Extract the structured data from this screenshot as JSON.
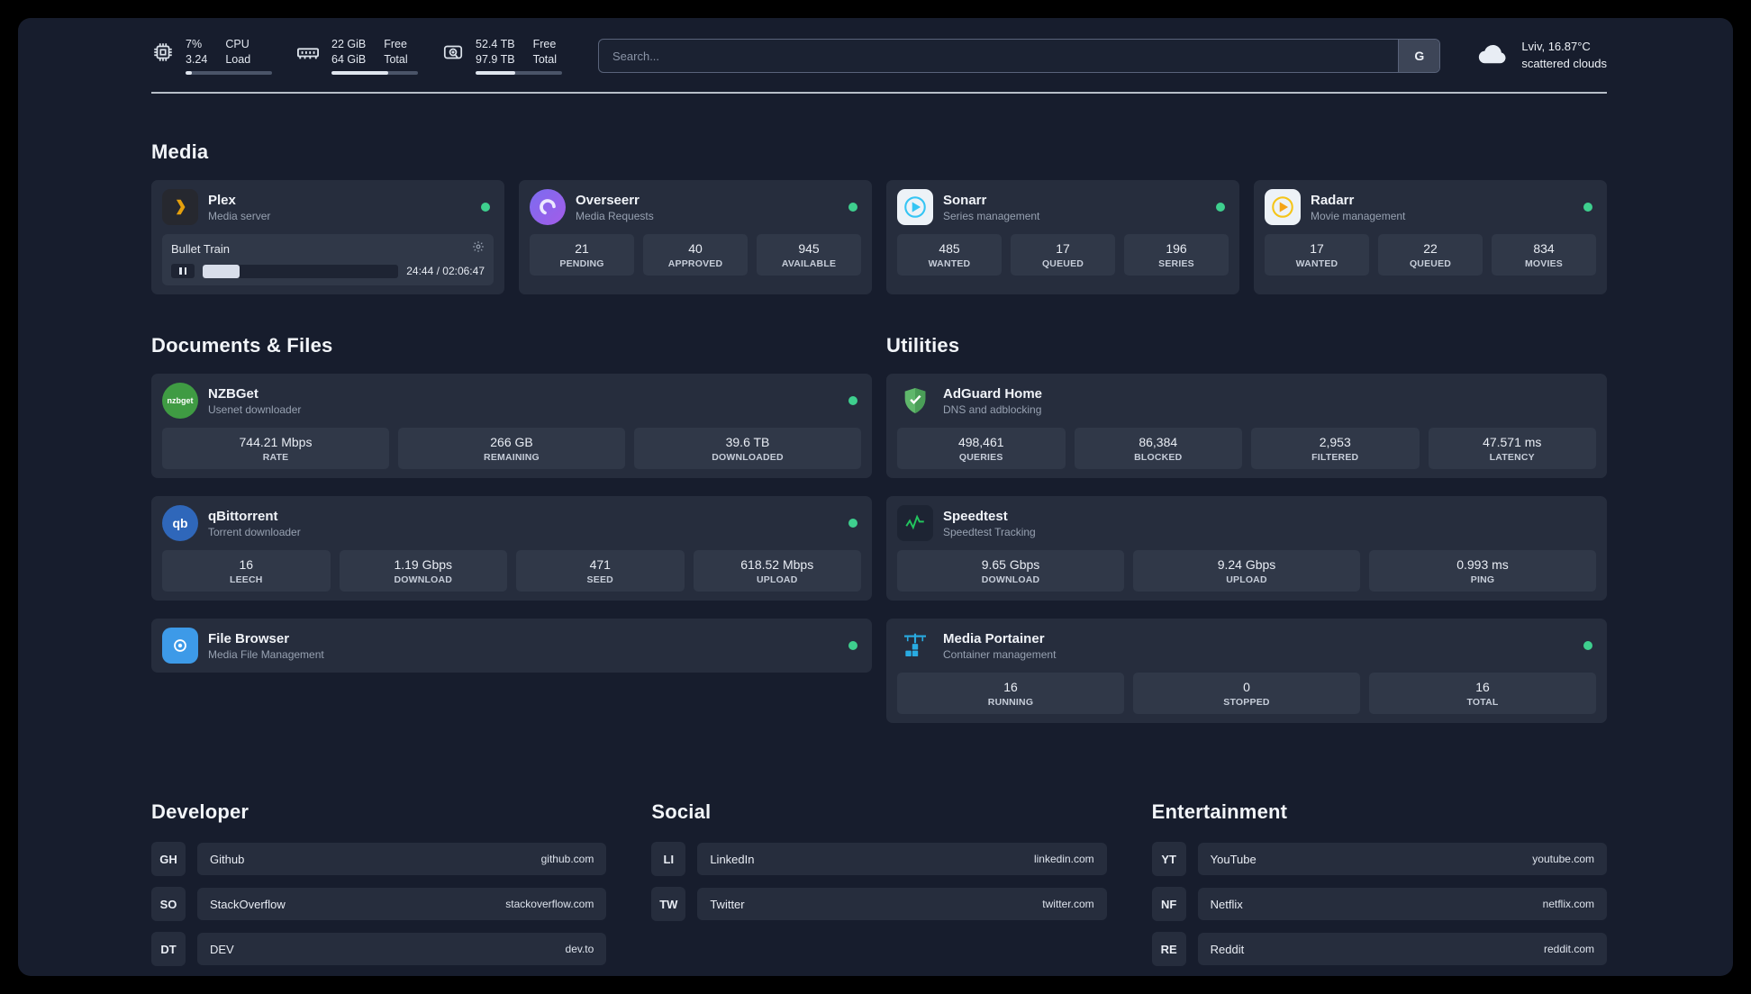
{
  "topbar": {
    "cpu": {
      "percent": "7%",
      "load": "3.24",
      "label1": "CPU",
      "label2": "Load"
    },
    "ram": {
      "free": "22 GiB",
      "total": "64 GiB",
      "label1": "Free",
      "label2": "Total"
    },
    "disk": {
      "free": "52.4 TB",
      "total": "97.9 TB",
      "label1": "Free",
      "label2": "Total"
    },
    "search": {
      "placeholder": "Search...",
      "button": "G"
    },
    "weather": {
      "location": "Lviv, 16.87°C",
      "condition": "scattered clouds"
    }
  },
  "media": {
    "title": "Media",
    "plex": {
      "name": "Plex",
      "subtitle": "Media server",
      "track": "Bullet Train",
      "time": "24:44 / 02:06:47"
    },
    "apps": [
      {
        "name": "Overseerr",
        "subtitle": "Media Requests",
        "stats": [
          {
            "value": "21",
            "label": "PENDING"
          },
          {
            "value": "40",
            "label": "APPROVED"
          },
          {
            "value": "945",
            "label": "AVAILABLE"
          }
        ]
      },
      {
        "name": "Sonarr",
        "subtitle": "Series management",
        "stats": [
          {
            "value": "485",
            "label": "WANTED"
          },
          {
            "value": "17",
            "label": "QUEUED"
          },
          {
            "value": "196",
            "label": "SERIES"
          }
        ]
      },
      {
        "name": "Radarr",
        "subtitle": "Movie management",
        "stats": [
          {
            "value": "17",
            "label": "WANTED"
          },
          {
            "value": "22",
            "label": "QUEUED"
          },
          {
            "value": "834",
            "label": "MOVIES"
          }
        ]
      }
    ]
  },
  "docs": {
    "title": "Documents & Files",
    "apps": [
      {
        "name": "NZBGet",
        "subtitle": "Usenet downloader",
        "icon_text": "nzbget",
        "stats": [
          {
            "value": "744.21 Mbps",
            "label": "RATE"
          },
          {
            "value": "266 GB",
            "label": "REMAINING"
          },
          {
            "value": "39.6 TB",
            "label": "DOWNLOADED"
          }
        ]
      },
      {
        "name": "qBittorrent",
        "subtitle": "Torrent downloader",
        "icon_text": "qb",
        "stats": [
          {
            "value": "16",
            "label": "LEECH"
          },
          {
            "value": "1.19 Gbps",
            "label": "DOWNLOAD"
          },
          {
            "value": "471",
            "label": "SEED"
          },
          {
            "value": "618.52 Mbps",
            "label": "UPLOAD"
          }
        ]
      },
      {
        "name": "File Browser",
        "subtitle": "Media File Management",
        "stats": []
      }
    ]
  },
  "utils": {
    "title": "Utilities",
    "apps": [
      {
        "name": "AdGuard Home",
        "subtitle": "DNS and adblocking",
        "stats": [
          {
            "value": "498,461",
            "label": "QUERIES"
          },
          {
            "value": "86,384",
            "label": "BLOCKED"
          },
          {
            "value": "2,953",
            "label": "FILTERED"
          },
          {
            "value": "47.571 ms",
            "label": "LATENCY"
          }
        ]
      },
      {
        "name": "Speedtest",
        "subtitle": "Speedtest Tracking",
        "stats": [
          {
            "value": "9.65 Gbps",
            "label": "DOWNLOAD"
          },
          {
            "value": "9.24 Gbps",
            "label": "UPLOAD"
          },
          {
            "value": "0.993 ms",
            "label": "PING"
          }
        ]
      },
      {
        "name": "Media Portainer",
        "subtitle": "Container management",
        "stats": [
          {
            "value": "16",
            "label": "RUNNING"
          },
          {
            "value": "0",
            "label": "STOPPED"
          },
          {
            "value": "16",
            "label": "TOTAL"
          }
        ]
      }
    ]
  },
  "bookmarks": {
    "groups": [
      {
        "title": "Developer",
        "items": [
          {
            "abbr": "GH",
            "name": "Github",
            "url": "github.com"
          },
          {
            "abbr": "SO",
            "name": "StackOverflow",
            "url": "stackoverflow.com"
          },
          {
            "abbr": "DT",
            "name": "DEV",
            "url": "dev.to"
          }
        ]
      },
      {
        "title": "Social",
        "items": [
          {
            "abbr": "LI",
            "name": "LinkedIn",
            "url": "linkedin.com"
          },
          {
            "abbr": "TW",
            "name": "Twitter",
            "url": "twitter.com"
          }
        ]
      },
      {
        "title": "Entertainment",
        "items": [
          {
            "abbr": "YT",
            "name": "YouTube",
            "url": "youtube.com"
          },
          {
            "abbr": "NF",
            "name": "Netflix",
            "url": "netflix.com"
          },
          {
            "abbr": "RE",
            "name": "Reddit",
            "url": "reddit.com"
          }
        ]
      }
    ]
  }
}
